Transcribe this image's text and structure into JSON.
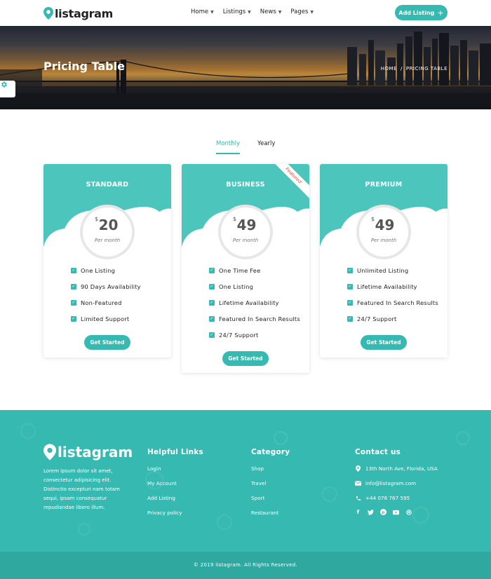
{
  "brand": {
    "name": "listagram",
    "accent": "#36b9b0"
  },
  "nav": {
    "items": [
      {
        "label": "Home"
      },
      {
        "label": "Listings"
      },
      {
        "label": "News"
      },
      {
        "label": "Pages"
      }
    ],
    "add_listing_label": "Add Listing"
  },
  "hero": {
    "title": "Pricing Table",
    "breadcrumb_home": "HOME",
    "breadcrumb_sep": "/",
    "breadcrumb_current": "PRICING TABLE"
  },
  "tabs": {
    "monthly": "Monthly",
    "yearly": "Yearly",
    "active": "Monthly"
  },
  "plans": [
    {
      "name": "STANDARD",
      "currency": "$",
      "price": "20",
      "period": "Per month",
      "features": [
        "One Listing",
        "90 Days Availability",
        "Non-Featured",
        "Limited Support"
      ],
      "button": "Get Started"
    },
    {
      "name": "BUSINESS",
      "currency": "$",
      "price": "49",
      "period": "Per month",
      "badge": "Featured",
      "features": [
        "One Time Fee",
        "One Listing",
        "Lifetime Availability",
        "Featured In Search Results",
        "24/7 Support"
      ],
      "button": "Get Started"
    },
    {
      "name": "PREMIUM",
      "currency": "$",
      "price": "49",
      "period": "Per month",
      "features": [
        "Unlimited Listing",
        "Lifetime Availability",
        "Featured In Search Results",
        "24/7 Support"
      ],
      "button": "Get Started"
    }
  ],
  "footer": {
    "about": "Lorem ipsum dolor sit amet, consectetur adipisicing elit. Distinctio excepturi nam totam sequi, ipsam consequatur repudiandae libero illum.",
    "helpful_title": "Helpful Links",
    "helpful_links": [
      "Login",
      "My Account",
      "Add Listing",
      "Privacy policy"
    ],
    "category_title": "Category",
    "categories": [
      "Shop",
      "Travel",
      "Sport",
      "Restaurant"
    ],
    "contact_title": "Contact us",
    "address": "13th North Ave, Florida, USA",
    "email": "info@listagram.com",
    "phone": "+44 078 767 595",
    "socials": [
      "facebook-icon",
      "twitter-icon",
      "pinterest-icon",
      "youtube-icon",
      "dribbble-icon"
    ],
    "copyright": "© 2019 listagram. All Rights Reserved."
  }
}
